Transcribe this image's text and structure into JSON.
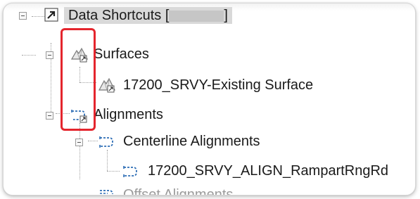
{
  "tree": {
    "root": {
      "label_prefix": "Data Shortcuts [",
      "label_suffix": "]",
      "icon": "shortcut-arrow-icon"
    },
    "surfaces": {
      "label": "Surfaces",
      "icon": "surface-folder-icon",
      "children": [
        {
          "label": "17200_SRVY-Existing Surface",
          "icon": "surface-icon"
        }
      ]
    },
    "alignments": {
      "label": "Alignments",
      "icon": "alignment-folder-icon",
      "children": [
        {
          "label": "Centerline Alignments",
          "icon": "centerline-alignment-icon",
          "children": [
            {
              "label": "17200_SRVY_ALIGN_RampartRngRd",
              "icon": "alignment-icon"
            }
          ]
        },
        {
          "label": "Offset Alignments",
          "icon": "offset-alignment-icon"
        }
      ]
    }
  },
  "colors": {
    "highlight": "#e4252d",
    "header_bg": "#d9d9d9"
  }
}
